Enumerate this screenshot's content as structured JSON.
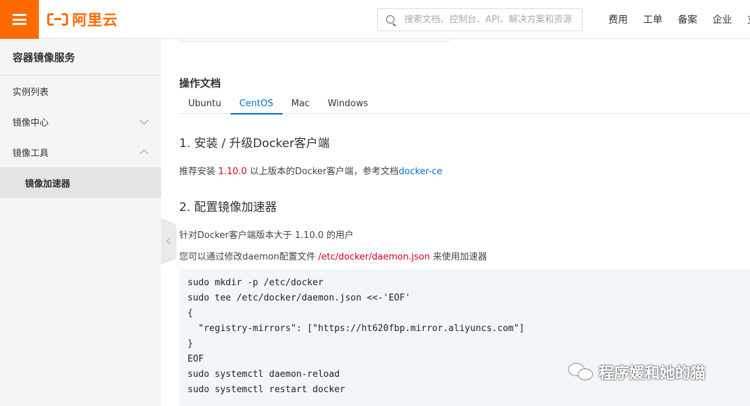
{
  "header": {
    "logo_text": "阿里云",
    "search_placeholder": "搜索文档、控制台、API、解决方案和资源",
    "nav": [
      "费用",
      "工单",
      "备案",
      "企业",
      "支"
    ]
  },
  "sidebar": {
    "title": "容器镜像服务",
    "items": [
      {
        "label": "实例列表"
      },
      {
        "label": "镜像中心"
      },
      {
        "label": "镜像工具"
      },
      {
        "label": "镜像加速器"
      }
    ]
  },
  "main": {
    "doc_title": "操作文档",
    "tabs": [
      "Ubuntu",
      "CentOS",
      "Mac",
      "Windows"
    ],
    "active_tab": "CentOS",
    "section1": {
      "heading": "1. 安装 / 升级Docker客户端",
      "text_before": "推荐安装 ",
      "version": "1.10.0",
      "text_middle": " 以上版本的Docker客户端，参考文档",
      "link": "docker-ce"
    },
    "section2": {
      "heading": "2. 配置镜像加速器",
      "line1": "针对Docker客户端版本大于 1.10.0 的用户",
      "line2_before": "您可以通过修改daemon配置文件 ",
      "path": "/etc/docker/daemon.json",
      "line2_after": " 来使用加速器"
    },
    "code_lines": [
      "sudo mkdir -p /etc/docker",
      "sudo tee /etc/docker/daemon.json <<-'EOF'",
      "{",
      "  \"registry-mirrors\": [\"https://ht620fbp.mirror.aliyuncs.com\"]",
      "}",
      "EOF",
      "sudo systemctl daemon-reload",
      "sudo systemctl restart docker"
    ]
  },
  "watermark": "程序媛和她的猫",
  "colors": {
    "brand": "#ff6a00",
    "link": "#0070cc",
    "highlight": "#d0021b",
    "code_bg": "#f1f6fb"
  }
}
